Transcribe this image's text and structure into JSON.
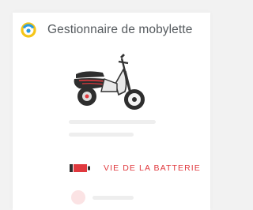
{
  "app": {
    "title": "Gestionnaire de mobylette",
    "icon": "ring-icon"
  },
  "vehicle": {
    "image": "scooter-image"
  },
  "battery": {
    "label": "VIE DE LA BATTERIE",
    "color": "#e0393e"
  },
  "colors": {
    "accent_yellow": "#f5c518",
    "accent_blue": "#2a9be0",
    "battery_red": "#e0393e",
    "battery_dark": "#2e2e2e"
  }
}
